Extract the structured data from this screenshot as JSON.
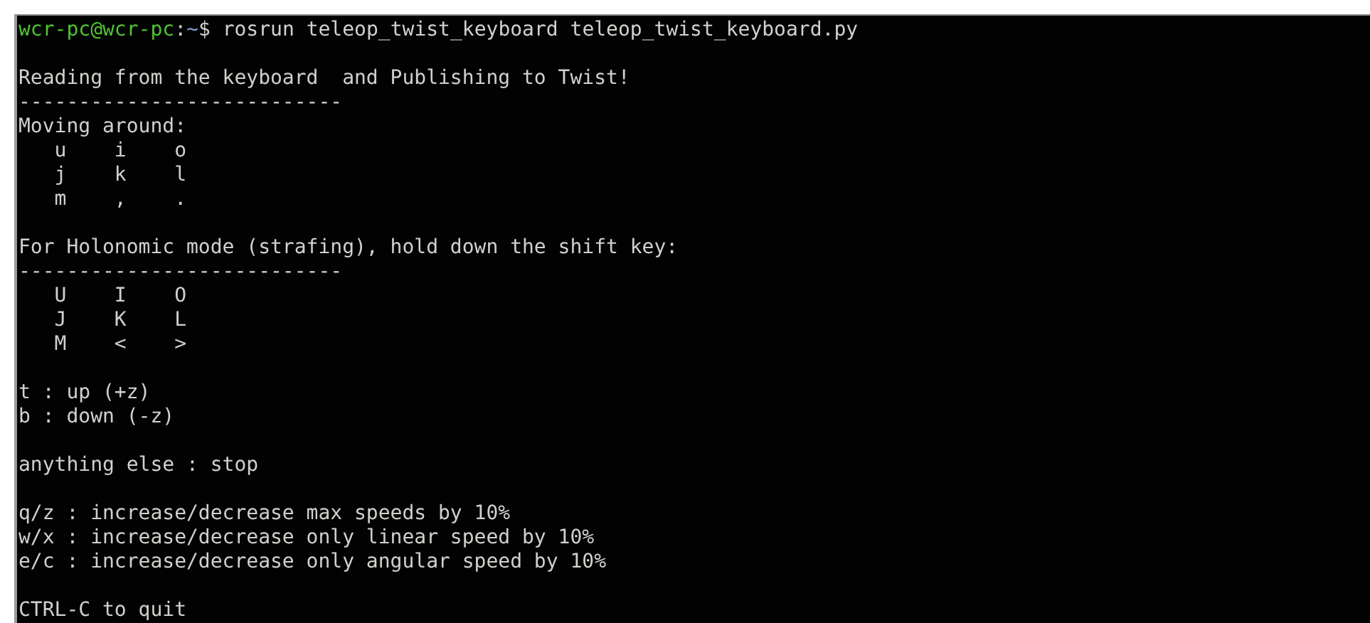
{
  "terminal": {
    "lines": [
      {
        "kind": "prompt",
        "user_host": "wcr-pc@wcr-pc",
        "separator": ":",
        "path": "~",
        "symbol": "$",
        "command": "rosrun teleop_twist_keyboard teleop_twist_keyboard.py"
      },
      {
        "kind": "blank"
      },
      {
        "kind": "text",
        "text": "Reading from the keyboard  and Publishing to Twist!"
      },
      {
        "kind": "rule",
        "text": "---------------------------"
      },
      {
        "kind": "text",
        "text": "Moving around:"
      },
      {
        "kind": "text",
        "text": "   u    i    o"
      },
      {
        "kind": "text",
        "text": "   j    k    l"
      },
      {
        "kind": "text",
        "text": "   m    ,    ."
      },
      {
        "kind": "blank"
      },
      {
        "kind": "text",
        "text": "For Holonomic mode (strafing), hold down the shift key:"
      },
      {
        "kind": "rule",
        "text": "---------------------------"
      },
      {
        "kind": "text",
        "text": "   U    I    O"
      },
      {
        "kind": "text",
        "text": "   J    K    L"
      },
      {
        "kind": "text",
        "text": "   M    <    >"
      },
      {
        "kind": "blank"
      },
      {
        "kind": "text",
        "text": "t : up (+z)"
      },
      {
        "kind": "text",
        "text": "b : down (-z)"
      },
      {
        "kind": "blank"
      },
      {
        "kind": "text",
        "text": "anything else : stop"
      },
      {
        "kind": "blank"
      },
      {
        "kind": "text",
        "text": "q/z : increase/decrease max speeds by 10%"
      },
      {
        "kind": "text",
        "text": "w/x : increase/decrease only linear speed by 10%"
      },
      {
        "kind": "text",
        "text": "e/c : increase/decrease only angular speed by 10%"
      },
      {
        "kind": "blank"
      },
      {
        "kind": "text",
        "text": "CTRL-C to quit"
      }
    ]
  }
}
